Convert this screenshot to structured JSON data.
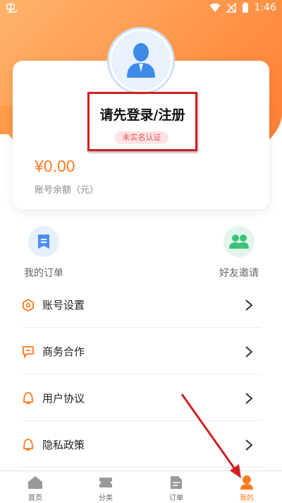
{
  "statusbar": {
    "time": "1:46",
    "app_icon": "app-logo-icon"
  },
  "profile": {
    "login_title": "请先登录/注册",
    "verify_badge": "未实名认证",
    "balance_amount": "¥0.00",
    "balance_label": "账号余额（元）"
  },
  "quick_actions": [
    {
      "label": "我的订单",
      "icon": "order-doc-icon",
      "color": "#4a8ef0"
    },
    {
      "label": "好友邀请",
      "icon": "friends-icon",
      "color": "#3cc37a"
    }
  ],
  "menu": [
    {
      "label": "账号设置",
      "icon": "settings-icon"
    },
    {
      "label": "商务合作",
      "icon": "chat-icon"
    },
    {
      "label": "用户协议",
      "icon": "agreement-icon"
    },
    {
      "label": "隐私政策",
      "icon": "privacy-icon"
    }
  ],
  "tabbar": [
    {
      "label": "首页",
      "icon": "home-icon"
    },
    {
      "label": "分类",
      "icon": "category-icon"
    },
    {
      "label": "订单",
      "icon": "order-icon"
    },
    {
      "label": "我的",
      "icon": "user-icon",
      "active": true
    }
  ],
  "colors": {
    "accent": "#ff7a1f",
    "highlight": "#d32020"
  }
}
